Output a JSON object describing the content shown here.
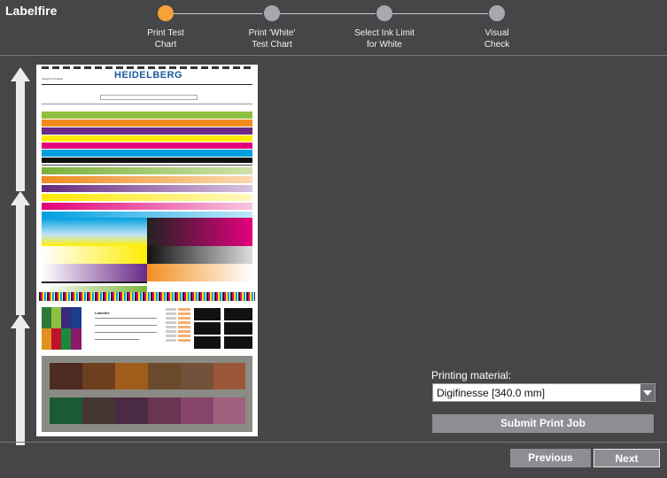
{
  "app": {
    "title": "Labelfire"
  },
  "steps": [
    {
      "label": "Print Test\nChart",
      "state": "active"
    },
    {
      "label": "Print 'White'\nTest Chart",
      "state": "pending"
    },
    {
      "label": "Select Ink Limit\nfor White",
      "state": "pending"
    },
    {
      "label": "Visual\nCheck",
      "state": "pending"
    }
  ],
  "chart_preview": {
    "brand": "HEIDELBERG",
    "product": "Labelfire"
  },
  "form": {
    "material_label": "Printing material:",
    "material_value": "Digifinesse [340.0 mm]",
    "submit_label": "Submit Print Job"
  },
  "nav": {
    "previous_label": "Previous",
    "next_label": "Next"
  },
  "colors": {
    "accent": "#f6a13a",
    "background": "#464649",
    "button": "#8d8e92"
  }
}
